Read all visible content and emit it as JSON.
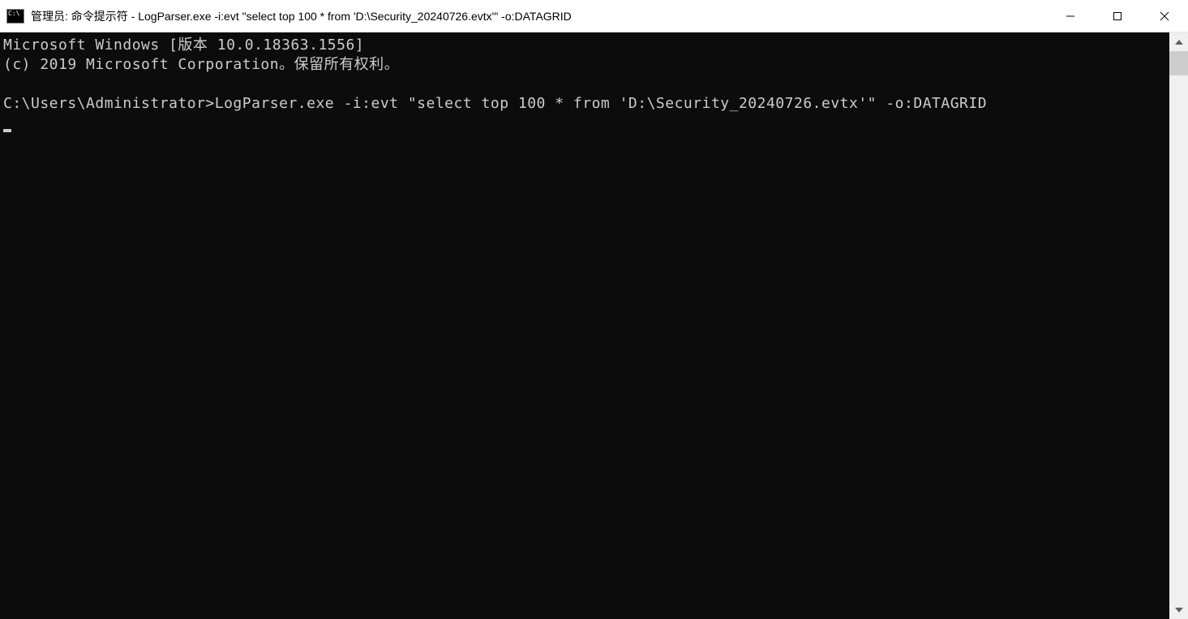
{
  "window": {
    "title": "管理员: 命令提示符 - LogParser.exe  -i:evt \"select top 100 * from 'D:\\Security_20240726.evtx'\" -o:DATAGRID"
  },
  "console": {
    "line1": "Microsoft Windows [版本 10.0.18363.1556]",
    "line2": "(c) 2019 Microsoft Corporation。保留所有权利。",
    "prompt": "C:\\Users\\Administrator>",
    "command": "LogParser.exe -i:evt \"select top 100 * from 'D:\\Security_20240726.evtx'\" -o:DATAGRID"
  }
}
